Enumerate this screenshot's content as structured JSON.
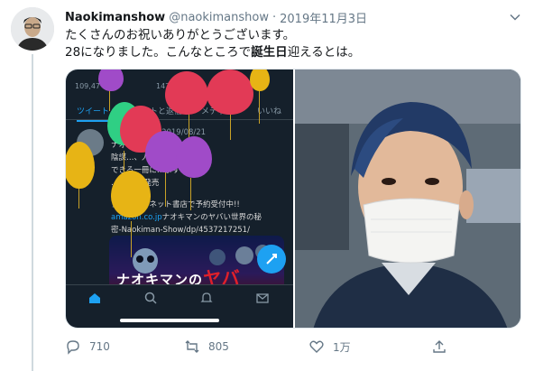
{
  "tweet": {
    "display_name": "Naokimanshow",
    "handle": "@naokimanshow",
    "separator": "·",
    "date": "2019年11月3日",
    "text_line1": "たくさんのお祝いありがとうございます。",
    "text_line2_before": "28になりました。こんなところで",
    "text_line2_bold": "誕生日",
    "text_line2_after": "迎えるとは。"
  },
  "embedded_screenshot": {
    "status_time": "109,47",
    "status_right": "147,",
    "tabs": [
      "ツイート",
      "ツイートと返信",
      "メディア",
      "いいね"
    ],
    "active_tab": "ツイート",
    "inner_tweet": {
      "meta": "@naokim... · 2019/08/21",
      "line1": "ナオキマンの本が出ます!!",
      "line2": "陰謀…、人を見直すことが",
      "line3": "できる一冊に…ます!",
      "line4": "…月19日発売",
      "line5": "アマゾン・ネット書店で予約受付中!!",
      "link1": "amazon.co.jp",
      "line6_rest": "ナオキマンのヤバい世界の秘",
      "line7": "密-Naokiman-Show/dp/4537217251/"
    },
    "book_title_a": "ナオキマンの",
    "book_title_b": "ヤバ"
  },
  "actions": {
    "reply_count": "710",
    "retweet_count": "805",
    "like_count": "1万"
  },
  "colors": {
    "accent": "#1da1f2",
    "text_primary": "#14171a",
    "text_secondary": "#657786",
    "dark_bg": "#15202b"
  },
  "icons": {
    "reply": "speech-bubble-icon",
    "retweet": "retweet-arrows-icon",
    "like": "heart-outline-icon",
    "share": "share-upload-icon",
    "menu": "chevron-down-icon"
  }
}
